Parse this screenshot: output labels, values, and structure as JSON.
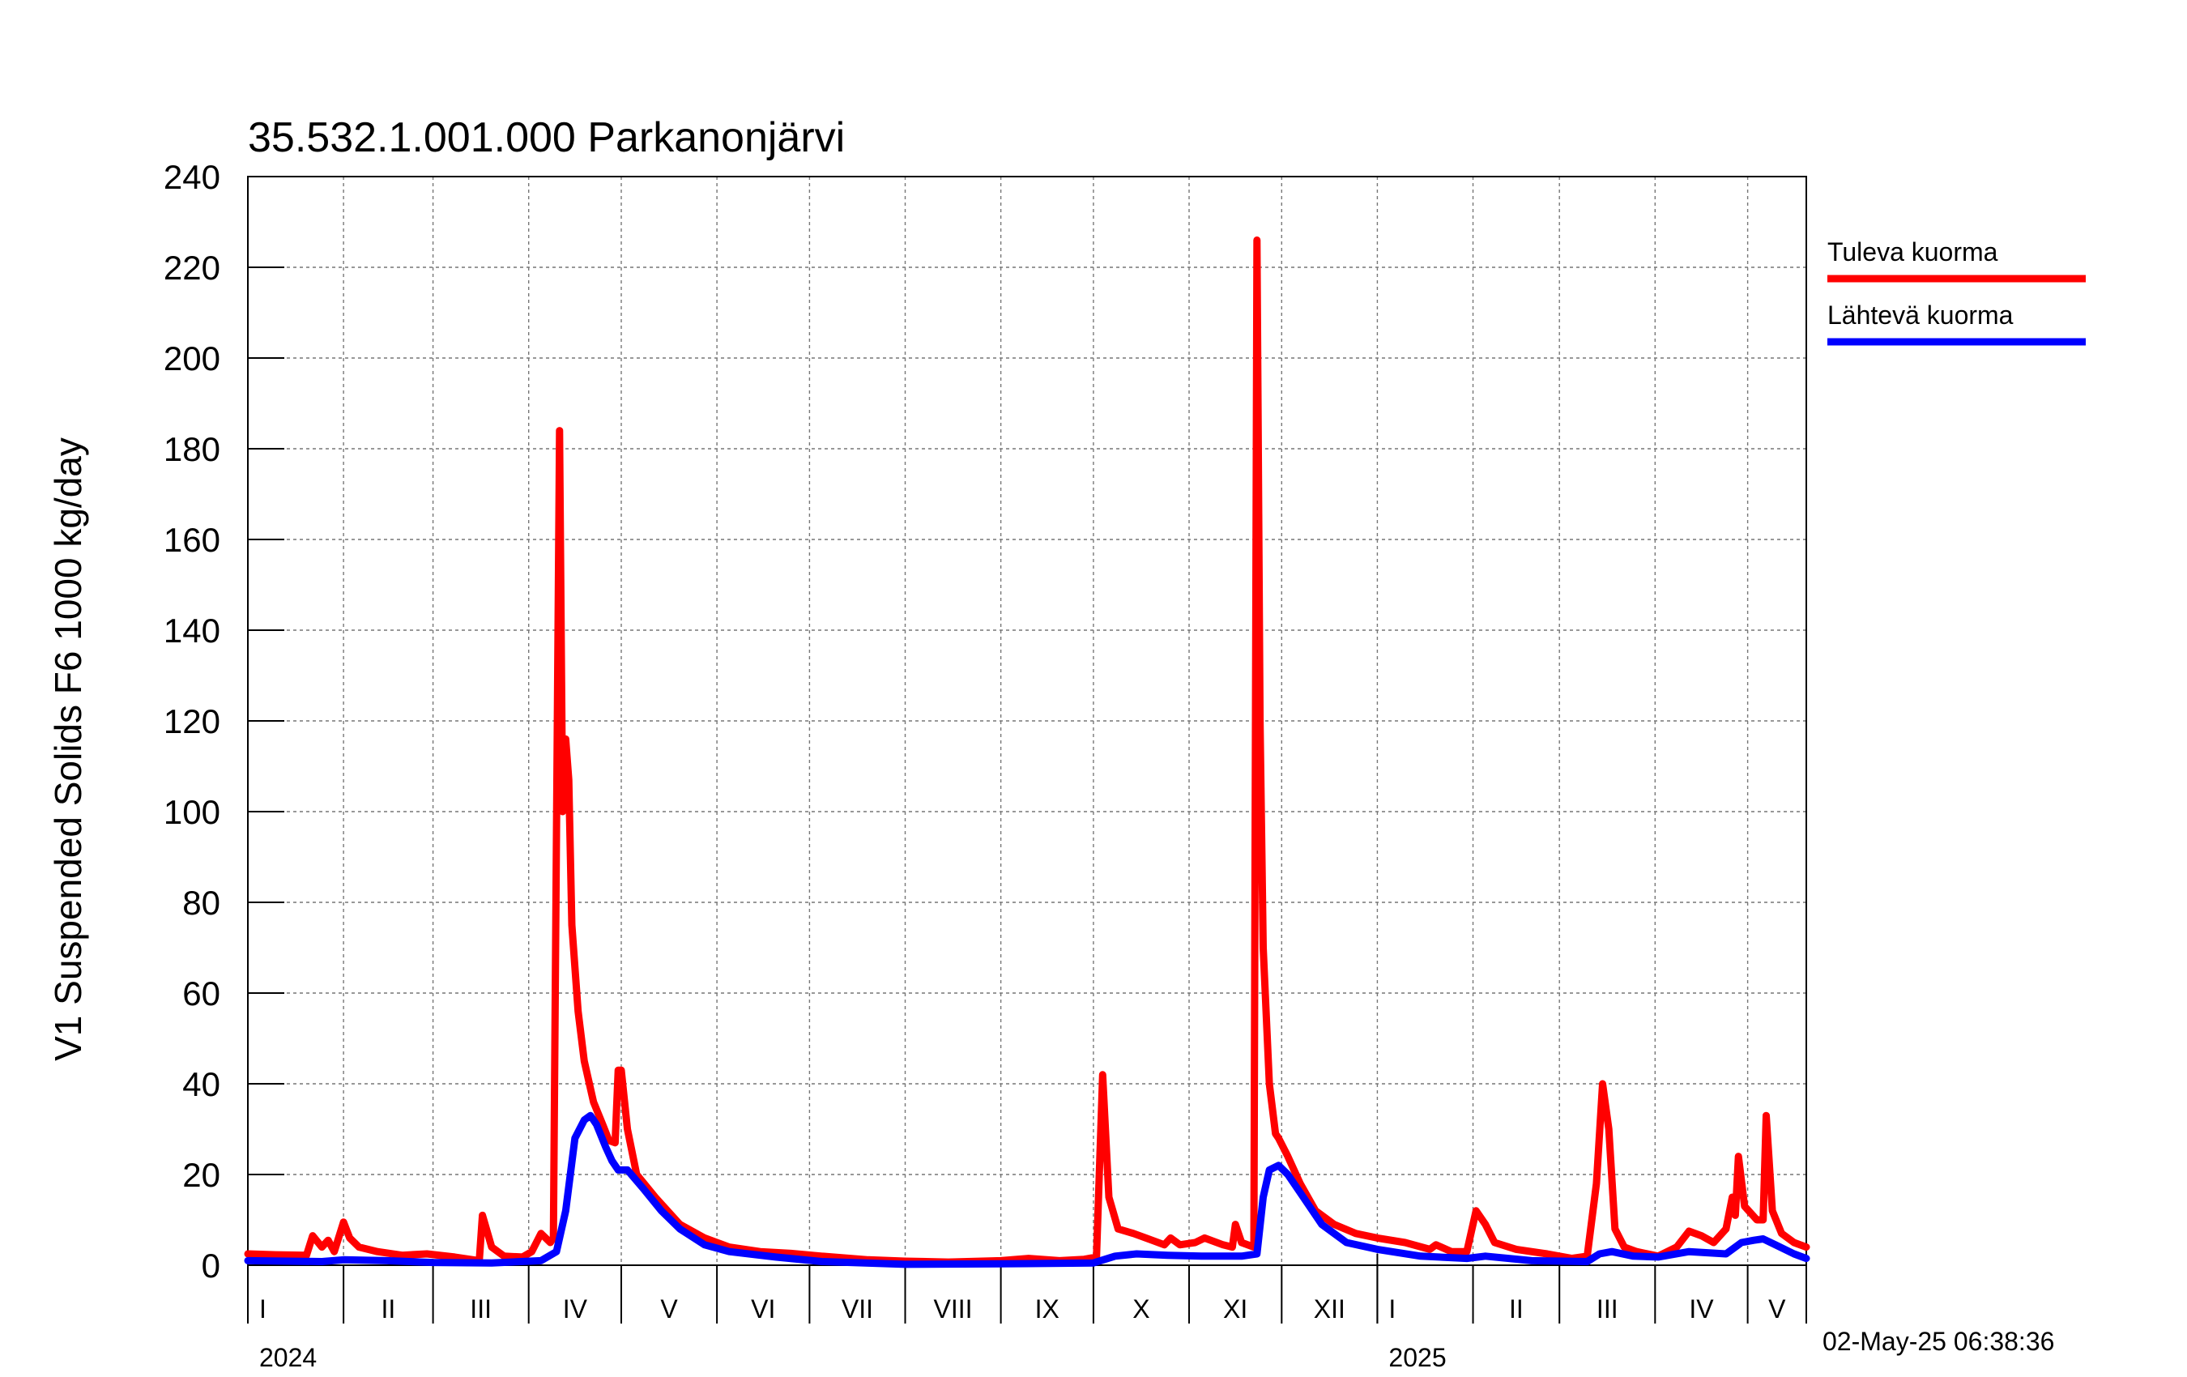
{
  "title": "35.532.1.001.000 Parkanonjärvi",
  "timestamp": "02-May-25 06:38:36",
  "chart_data": {
    "type": "line",
    "title": "35.532.1.001.000 Parkanonjärvi",
    "ylabel": "V1 Suspended Solids F6 1000 kg/day",
    "xlabel": "",
    "ylim": [
      0,
      240
    ],
    "yticks": [
      0,
      20,
      40,
      60,
      80,
      100,
      120,
      140,
      160,
      180,
      200,
      220,
      240
    ],
    "xlim": [
      "2024-01-01",
      "2025-05-20"
    ],
    "grid": true,
    "legend_position": "right",
    "month_labels": [
      {
        "label": "I",
        "date": "2024-01-01"
      },
      {
        "label": "II",
        "date": "2024-02-01"
      },
      {
        "label": "III",
        "date": "2024-03-01"
      },
      {
        "label": "IV",
        "date": "2024-04-01"
      },
      {
        "label": "V",
        "date": "2024-05-01"
      },
      {
        "label": "VI",
        "date": "2024-06-01"
      },
      {
        "label": "VII",
        "date": "2024-07-01"
      },
      {
        "label": "VIII",
        "date": "2024-08-01"
      },
      {
        "label": "IX",
        "date": "2024-09-01"
      },
      {
        "label": "X",
        "date": "2024-10-01"
      },
      {
        "label": "XI",
        "date": "2024-11-01"
      },
      {
        "label": "XII",
        "date": "2024-12-01"
      },
      {
        "label": "I",
        "date": "2025-01-01"
      },
      {
        "label": "II",
        "date": "2025-02-01"
      },
      {
        "label": "III",
        "date": "2025-03-01"
      },
      {
        "label": "IV",
        "date": "2025-04-01"
      },
      {
        "label": "V",
        "date": "2025-05-01"
      }
    ],
    "year_labels": [
      {
        "label": "2024",
        "date": "2024-01-01"
      },
      {
        "label": "2025",
        "date": "2025-01-01"
      }
    ],
    "series": [
      {
        "name": "Tuleva kuorma",
        "color": "#ff0000",
        "points": [
          [
            "2024-01-01",
            2.5
          ],
          [
            "2024-01-10",
            2.3
          ],
          [
            "2024-01-20",
            2.2
          ],
          [
            "2024-01-22",
            6.5
          ],
          [
            "2024-01-25",
            4.0
          ],
          [
            "2024-01-27",
            5.5
          ],
          [
            "2024-01-29",
            3.0
          ],
          [
            "2024-02-01",
            9.5
          ],
          [
            "2024-02-03",
            6.0
          ],
          [
            "2024-02-06",
            4.0
          ],
          [
            "2024-02-12",
            3.0
          ],
          [
            "2024-02-20",
            2.2
          ],
          [
            "2024-02-28",
            2.5
          ],
          [
            "2024-03-08",
            1.8
          ],
          [
            "2024-03-16",
            1.0
          ],
          [
            "2024-03-17",
            11.0
          ],
          [
            "2024-03-20",
            4.0
          ],
          [
            "2024-03-24",
            2.0
          ],
          [
            "2024-03-30",
            1.8
          ],
          [
            "2024-04-02",
            3.0
          ],
          [
            "2024-04-05",
            7.0
          ],
          [
            "2024-04-08",
            5.0
          ],
          [
            "2024-04-09",
            6.0
          ],
          [
            "2024-04-11",
            184
          ],
          [
            "2024-04-12",
            100
          ],
          [
            "2024-04-13",
            116
          ],
          [
            "2024-04-14",
            107
          ],
          [
            "2024-04-15",
            75
          ],
          [
            "2024-04-17",
            56
          ],
          [
            "2024-04-19",
            45
          ],
          [
            "2024-04-22",
            36
          ],
          [
            "2024-04-25",
            31
          ],
          [
            "2024-04-27",
            27.5
          ],
          [
            "2024-04-29",
            27
          ],
          [
            "2024-04-30",
            43
          ],
          [
            "2024-05-01",
            43
          ],
          [
            "2024-05-03",
            30
          ],
          [
            "2024-05-06",
            20
          ],
          [
            "2024-05-12",
            15
          ],
          [
            "2024-05-20",
            9
          ],
          [
            "2024-05-28",
            6
          ],
          [
            "2024-06-05",
            4
          ],
          [
            "2024-06-15",
            3
          ],
          [
            "2024-06-25",
            2.6
          ],
          [
            "2024-07-05",
            2.0
          ],
          [
            "2024-07-20",
            1.2
          ],
          [
            "2024-08-01",
            0.9
          ],
          [
            "2024-08-15",
            0.7
          ],
          [
            "2024-09-01",
            1.0
          ],
          [
            "2024-09-10",
            1.5
          ],
          [
            "2024-09-20",
            1.0
          ],
          [
            "2024-09-28",
            1.3
          ],
          [
            "2024-10-02",
            1.8
          ],
          [
            "2024-10-04",
            42
          ],
          [
            "2024-10-06",
            15
          ],
          [
            "2024-10-09",
            8
          ],
          [
            "2024-10-14",
            7
          ],
          [
            "2024-10-20",
            5.5
          ],
          [
            "2024-10-24",
            4.5
          ],
          [
            "2024-10-26",
            6
          ],
          [
            "2024-10-29",
            4.5
          ],
          [
            "2024-11-03",
            5.0
          ],
          [
            "2024-11-06",
            6
          ],
          [
            "2024-11-12",
            4.5
          ],
          [
            "2024-11-15",
            4.0
          ],
          [
            "2024-11-16",
            9
          ],
          [
            "2024-11-18",
            5
          ],
          [
            "2024-11-22",
            4
          ],
          [
            "2024-11-23",
            226
          ],
          [
            "2024-11-24",
            120
          ],
          [
            "2024-11-25",
            70
          ],
          [
            "2024-11-27",
            40
          ],
          [
            "2024-11-29",
            29
          ],
          [
            "2024-11-30",
            28
          ],
          [
            "2024-12-03",
            24
          ],
          [
            "2024-12-07",
            18
          ],
          [
            "2024-12-12",
            12
          ],
          [
            "2024-12-18",
            9
          ],
          [
            "2024-12-25",
            7
          ],
          [
            "2025-01-01",
            6
          ],
          [
            "2025-01-10",
            5
          ],
          [
            "2025-01-18",
            3.5
          ],
          [
            "2025-01-20",
            4.5
          ],
          [
            "2025-01-25",
            3.0
          ],
          [
            "2025-01-30",
            3.0
          ],
          [
            "2025-02-02",
            12
          ],
          [
            "2025-02-05",
            9
          ],
          [
            "2025-02-08",
            5
          ],
          [
            "2025-02-15",
            3.5
          ],
          [
            "2025-02-25",
            2.5
          ],
          [
            "2025-03-05",
            1.5
          ],
          [
            "2025-03-10",
            2.0
          ],
          [
            "2025-03-13",
            18
          ],
          [
            "2025-03-15",
            40
          ],
          [
            "2025-03-17",
            30
          ],
          [
            "2025-03-19",
            8
          ],
          [
            "2025-03-22",
            4
          ],
          [
            "2025-03-26",
            3
          ],
          [
            "2025-04-02",
            2
          ],
          [
            "2025-04-08",
            4
          ],
          [
            "2025-04-12",
            7.5
          ],
          [
            "2025-04-16",
            6.5
          ],
          [
            "2025-04-20",
            5
          ],
          [
            "2025-04-24",
            8
          ],
          [
            "2025-04-26",
            15
          ],
          [
            "2025-04-27",
            11
          ],
          [
            "2025-04-28",
            24
          ],
          [
            "2025-04-30",
            13
          ],
          [
            "2025-05-04",
            10
          ],
          [
            "2025-05-06",
            10
          ],
          [
            "2025-05-07",
            33
          ],
          [
            "2025-05-09",
            12
          ],
          [
            "2025-05-12",
            7
          ],
          [
            "2025-05-16",
            5
          ],
          [
            "2025-05-20",
            4
          ]
        ]
      },
      {
        "name": "Lähtevä kuorma",
        "color": "#0000ff",
        "points": [
          [
            "2024-01-01",
            1.0
          ],
          [
            "2024-01-25",
            0.8
          ],
          [
            "2024-02-01",
            1.2
          ],
          [
            "2024-02-15",
            1.0
          ],
          [
            "2024-03-01",
            0.6
          ],
          [
            "2024-03-20",
            0.5
          ],
          [
            "2024-04-05",
            1.0
          ],
          [
            "2024-04-10",
            3.0
          ],
          [
            "2024-04-13",
            12
          ],
          [
            "2024-04-16",
            28
          ],
          [
            "2024-04-19",
            32
          ],
          [
            "2024-04-21",
            33
          ],
          [
            "2024-04-23",
            31
          ],
          [
            "2024-04-26",
            26
          ],
          [
            "2024-04-28",
            23
          ],
          [
            "2024-04-30",
            21
          ],
          [
            "2024-05-03",
            21
          ],
          [
            "2024-05-08",
            17
          ],
          [
            "2024-05-14",
            12
          ],
          [
            "2024-05-20",
            8
          ],
          [
            "2024-05-28",
            4.5
          ],
          [
            "2024-06-05",
            3
          ],
          [
            "2024-06-20",
            1.8
          ],
          [
            "2024-07-05",
            0.8
          ],
          [
            "2024-08-01",
            0.2
          ],
          [
            "2024-09-01",
            0.3
          ],
          [
            "2024-10-01",
            0.5
          ],
          [
            "2024-10-08",
            2.0
          ],
          [
            "2024-10-15",
            2.5
          ],
          [
            "2024-10-25",
            2.2
          ],
          [
            "2024-11-05",
            2.0
          ],
          [
            "2024-11-18",
            2.0
          ],
          [
            "2024-11-23",
            2.5
          ],
          [
            "2024-11-25",
            15
          ],
          [
            "2024-11-27",
            21
          ],
          [
            "2024-11-30",
            22
          ],
          [
            "2024-12-03",
            20
          ],
          [
            "2024-12-08",
            15
          ],
          [
            "2024-12-14",
            9
          ],
          [
            "2024-12-22",
            5
          ],
          [
            "2025-01-01",
            3.5
          ],
          [
            "2025-01-15",
            2.0
          ],
          [
            "2025-01-30",
            1.5
          ],
          [
            "2025-02-05",
            2.0
          ],
          [
            "2025-02-20",
            1.0
          ],
          [
            "2025-03-10",
            0.8
          ],
          [
            "2025-03-14",
            2.5
          ],
          [
            "2025-03-18",
            3.0
          ],
          [
            "2025-03-25",
            2.0
          ],
          [
            "2025-04-02",
            1.8
          ],
          [
            "2025-04-12",
            3.0
          ],
          [
            "2025-04-24",
            2.5
          ],
          [
            "2025-04-29",
            5.0
          ],
          [
            "2025-05-03",
            5.5
          ],
          [
            "2025-05-06",
            5.8
          ],
          [
            "2025-05-10",
            4.5
          ],
          [
            "2025-05-16",
            2.5
          ],
          [
            "2025-05-20",
            1.5
          ]
        ]
      }
    ]
  }
}
